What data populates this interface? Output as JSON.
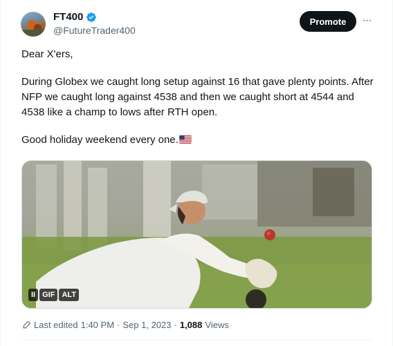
{
  "author": {
    "display_name": "FT400",
    "handle": "@FutureTrader400",
    "verified": true
  },
  "actions": {
    "promote_label": "Promote",
    "more_label": "···"
  },
  "tweet": {
    "greeting": "Dear X'ers,",
    "paragraph_1": "During Globex we caught long setup against 16 that gave plenty points. After NFP we caught long against 4538 and then we caught short at 4544 and 4538 like a champ to lows after RTH open.",
    "paragraph_2": "Good holiday weekend every one.",
    "paragraph_2_emoji": "us-flag-emoji"
  },
  "media": {
    "type": "gif",
    "badges": {
      "pause": "II",
      "gif": "GIF",
      "alt": "ALT"
    }
  },
  "meta": {
    "edited_label": "Last edited",
    "time": "1:40 PM",
    "separator": "·",
    "date": "Sep 1, 2023",
    "views_count": "1,088",
    "views_label": "Views"
  },
  "colors": {
    "text_primary": "#0f1419",
    "text_secondary": "#536471",
    "verified_blue": "#1d9bf0",
    "promote_bg": "#0f1419"
  }
}
